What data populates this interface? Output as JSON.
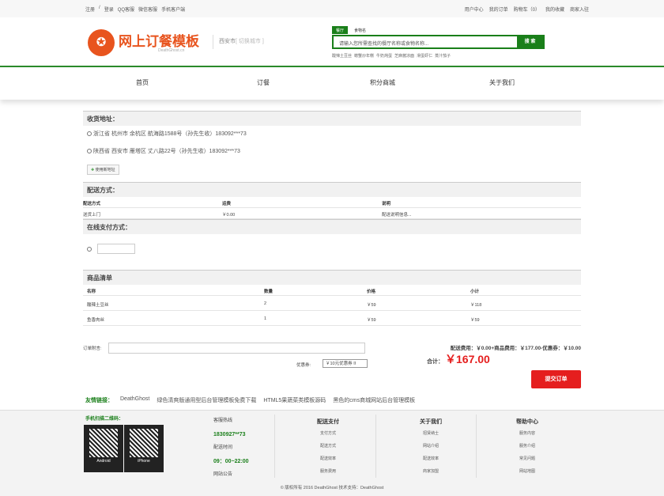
{
  "topbar": {
    "left": [
      "注册",
      "/",
      "登录",
      "QQ客服",
      "微信客服",
      "手机客户端"
    ],
    "right": [
      "用户中心",
      "我的订单",
      "购物车（0）",
      "我的收藏",
      "商家入驻"
    ]
  },
  "header": {
    "logo_glyph": "✪",
    "brand": "网上订餐模板",
    "brand_sub": "DeathGhost.cn",
    "city": "西安市",
    "city_switch": "[ 切换城市 ]",
    "search_tabs": [
      "餐厅",
      "食物名"
    ],
    "search_placeholder": "请输入您所需查找的餐厅名称或食物名称...",
    "search_button": "搜 索",
    "hot_words": [
      "酸辣土豆丝",
      "螃蟹炒年糕",
      "牛奶炖蛋",
      "芝麻酱凉面",
      "滑蛋虾仁",
      "蒸汁茄子"
    ]
  },
  "nav": [
    "首页",
    "订餐",
    "积分商城",
    "关于我们"
  ],
  "address": {
    "title": "收货地址：",
    "items": [
      "浙江省 杭州市 余杭区 航海路1588号（孙先生收）183092***73",
      "陕西省 西安市 雁塔区 丈八路22号（孙先生收）183092***73"
    ],
    "add_label": "使用新地址"
  },
  "delivery": {
    "title": "配送方式：",
    "headers": [
      "配送方式",
      "运费",
      "说明"
    ],
    "row": [
      "送货上门",
      "￥0.00",
      "配送说明信息..."
    ]
  },
  "payment": {
    "title": "在线支付方式："
  },
  "goods": {
    "title": "商品清单",
    "headers": [
      "名称",
      "数量",
      "价格",
      "小计"
    ],
    "rows": [
      [
        "酸辣土豆丝",
        "2",
        "￥59",
        "￥118"
      ],
      [
        "鱼香肉丝",
        "1",
        "￥59",
        "￥59"
      ]
    ]
  },
  "order": {
    "remark_label": "订单附言:",
    "coupon_label": "优惠券:",
    "coupon_value": "￥10元优惠券",
    "fees": "配送费用：￥0.00+商品费用：￥177.00-优惠券：￥10.00",
    "total_label": "合计：",
    "total_value": "￥167.00",
    "submit": "提交订单"
  },
  "links": {
    "title": "友情链接：",
    "items": [
      "DeathGhost",
      "绿色清爽版通用型后台管理模板免费下载",
      "HTML5果蔬菜类模板源码",
      "黑色的cms商城网站后台管理模板"
    ]
  },
  "footer": {
    "qr_title": "手机扫描二维码：",
    "qr_labels": [
      "Android",
      "iPhone"
    ],
    "hotline_label": "客服热线",
    "hotline": "1830927**73",
    "time_label": "配送时间",
    "time": "09：00~22:00",
    "notice_label": "网站公告",
    "columns": [
      {
        "title": "配送支付",
        "items": [
          "支付方式",
          "配送方式",
          "配送效率",
          "服务费用"
        ]
      },
      {
        "title": "关于我们",
        "items": [
          "招贤纳士",
          "网站介绍",
          "配送效率",
          "商家加盟"
        ]
      },
      {
        "title": "帮助中心",
        "items": [
          "服务内容",
          "服务介绍",
          "常见问题",
          "网站地图"
        ]
      }
    ],
    "copyright": "© 版权所有 2016 DeathGhost 技术支持：DeathGhost"
  }
}
